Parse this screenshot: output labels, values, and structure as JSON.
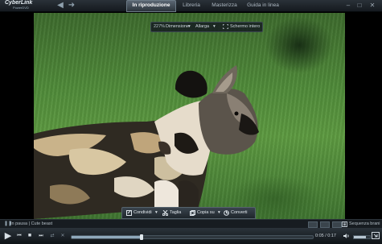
{
  "app": {
    "logo_line1": "CyberLink",
    "logo_line2": "PowerDVD"
  },
  "nav": {
    "back": "◀",
    "forward": "➜"
  },
  "tabs": [
    {
      "label": "In riproduzione",
      "active": true
    },
    {
      "label": "Libreria",
      "active": false
    },
    {
      "label": "Masterizza",
      "active": false
    },
    {
      "label": "Guida in linea",
      "active": false
    }
  ],
  "window_controls": {
    "minimize": "–",
    "maximize": "□",
    "close": "✕"
  },
  "view_toolbar": {
    "zoom": "227%",
    "dimension_label": "Dimensione",
    "fit_label": "Allarga",
    "fullscreen_label": "Schermo intero"
  },
  "actions": {
    "share": "Condividi",
    "cut": "Taglia",
    "copy": "Copia su",
    "convert": "Converti"
  },
  "status": {
    "pause_icon": "❚❚",
    "text": "In pausa | Cute beast",
    "sequence": "Sequenza brani"
  },
  "player": {
    "play_icon": "▶",
    "prev_icon": "⏮",
    "stop_icon": "■",
    "next_icon": "⏭",
    "mode_icon": "⇄",
    "shuffle_icon": "✕",
    "time": "0:05 / 0:17",
    "progress": 0.29,
    "volume": 0.75
  },
  "colors": {
    "accent": "#8fa8bb",
    "background": "#0b0f14"
  }
}
